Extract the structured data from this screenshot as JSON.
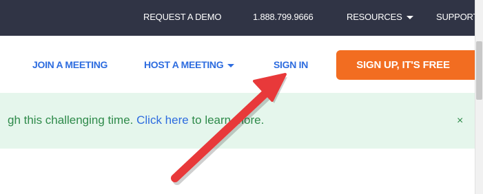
{
  "topbar": {
    "request_demo": "REQUEST A DEMO",
    "phone": "1.888.799.9666",
    "resources": "RESOURCES",
    "support": "SUPPORT"
  },
  "nav": {
    "join": "JOIN A MEETING",
    "host": "HOST A MEETING",
    "signin": "SIGN IN",
    "signup": "SIGN UP, IT'S FREE"
  },
  "banner": {
    "text_before": "gh this challenging time. ",
    "link_text": "Click here",
    "text_after": " to learn more.",
    "close": "×"
  },
  "colors": {
    "topbar_bg": "#303445",
    "link_blue": "#2d6cdf",
    "signup_orange": "#f26d21",
    "banner_bg": "#e5f6ec",
    "banner_text": "#2e8a4a",
    "arrow_red": "#e8393a"
  }
}
